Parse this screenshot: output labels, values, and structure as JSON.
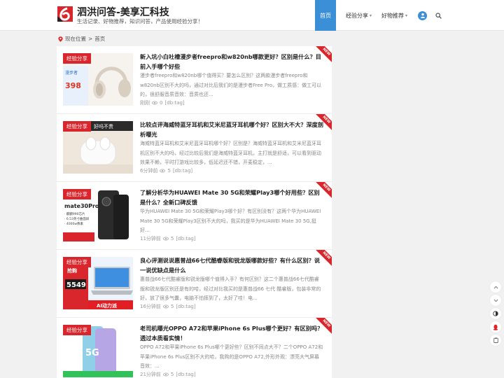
{
  "site": {
    "title": "泗洪问答-美享汇科技",
    "description": "生活记录、好物推荐，知识问答，产品使用经验分享！"
  },
  "nav": {
    "items": [
      {
        "label": "首页",
        "active": true
      },
      {
        "label": "经验分享",
        "active": false
      },
      {
        "label": "好物推荐",
        "active": false
      }
    ]
  },
  "breadcrumb": {
    "current_label": "现在位置",
    "separator": ">",
    "home": "首页"
  },
  "posts": [
    {
      "tag": "经验分享",
      "badge": "NEW",
      "title": "新入坑小白吐槽漫步者freepro和w820nb哪款更好？区别是什么？目前入手哪个好些",
      "excerpt": "漫步者freepro和w820nb哪个值得买？要怎么区别？这两款漫步者freepro和w820nb区别不大的吗，通过对比后我们的是漫步者Free Pro，做工质感：做工可以的，很舒服音质音效：音质也还...",
      "time": "刚刚",
      "views": "0",
      "db_tag": "[db:tag]"
    },
    {
      "tag": "经验分享",
      "badge": "NEW",
      "title": "比较点评海威特蓝牙耳机和艾米尼蓝牙耳机哪个好？区别大不大？深度剖析曝光",
      "excerpt": "海威特蓝牙耳机和艾米尼蓝牙耳机哪个好？区别是？海威特蓝牙耳机和艾米尼蓝牙耳机区别不大的吗，经过比较后我们是海威特蓝牙耳机，主打就是舒适，可以看到驱动效果不赖，平时打游戏比较多，低延迟还不错，开麦稳定，...",
      "time": "6分钟前",
      "views": "5",
      "db_tag": "[db:tag]"
    },
    {
      "tag": "经验分享",
      "badge": "NEW",
      "title": "了解分析华为HUAWEI Mate 30 5G和荣耀Play3哪个好用些？区别是什么？全新口碑反馈",
      "excerpt": "华为HUAWEI Mate 30 5G和荣耀Play3哪个好？有区别没有？这两个华为HUAWEI Mate 30 5G和荣耀Play3区别不大的吗，我买的是华为HUAWEI Mate 30 5G,挺好...",
      "time": "11分钟前",
      "views": "5",
      "db_tag": "[db:tag]"
    },
    {
      "tag": "经验分享",
      "badge": "NEW",
      "title": "良心评测说说惠普战66七代酷睿版和锐龙版哪款好些？有什么区别？说一说优缺点是什么",
      "excerpt": "惠普战66七代酷睿版和锐龙版哪个值得入手？有何区别？这二个惠普战66七代酷睿版和锐龙版区别还是有的哈，经过对比我买的是惠普战66 七代 酷睿版，包装非常的好，放了很多气囊，电脑不怕摔到了，太好了哇！电...",
      "time": "16分钟前",
      "views": "5",
      "db_tag": "[db:tag]"
    },
    {
      "tag": "经验分享",
      "badge": "NEW",
      "title": "老司机曝光OPPO A72和苹果iPhone 6s Plus哪个更好？有区别吗？透过本质看实情！",
      "excerpt": "OPPO A72和苹果iPhone 6s Plus哪个更好些？区别不同点大不？二个OPPO A72和苹果iPhone 6s Plus区别不大的哈，我购的是OPPO A72,外形外观：漂亮大气屏幕音效：...",
      "time": "21分钟前",
      "views": "5",
      "db_tag": "[db:tag]"
    }
  ],
  "thumb_texts": {
    "p1_price": "398",
    "p1_brand": "漫步者",
    "p2_text": "好吗不贵",
    "p3_model": "mate30Pro",
    "p3_line1": "· 麒麟990芯片",
    "p3_line2": "· 6.53英寸曲面屏",
    "p3_line3": "· 4000w像素",
    "p4_price": "5549",
    "p4_top": "抢购",
    "p4_bottom": "AI动力派",
    "p5_badge": "5G"
  },
  "colors": {
    "accent": "#3b8fd6",
    "tag_red": "#d8262c"
  }
}
